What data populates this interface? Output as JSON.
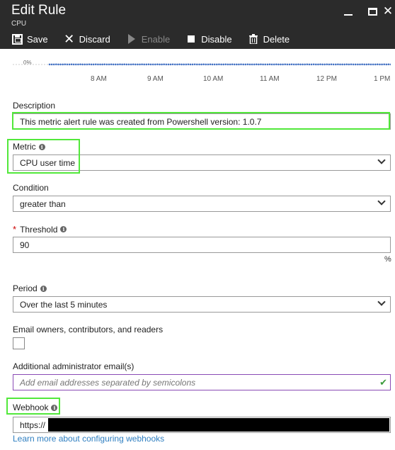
{
  "header": {
    "title": "Edit Rule",
    "subtitle": "CPU",
    "close_glyph": "✕"
  },
  "toolbar": {
    "save_label": "Save",
    "discard_label": "Discard",
    "enable_label": "Enable",
    "disable_label": "Disable",
    "delete_label": "Delete"
  },
  "chart_data": {
    "type": "line",
    "ylabel_tick": "0%",
    "x_ticks": [
      "8 AM",
      "9 AM",
      "10 AM",
      "11 AM",
      "12 PM",
      "1 PM"
    ],
    "series_color": "#4472c4",
    "ylim": [
      0,
      100
    ],
    "values": [
      2,
      3,
      2,
      4,
      3,
      2,
      3,
      5,
      2,
      3,
      4,
      2,
      3,
      2,
      6,
      3,
      2,
      3,
      4,
      2,
      3,
      5,
      2,
      3,
      2,
      4,
      3,
      2,
      5,
      3,
      2,
      3,
      4,
      2,
      6,
      3,
      2,
      3,
      4,
      2,
      3,
      2,
      5,
      3,
      2,
      4,
      3,
      2,
      3,
      5,
      2,
      3,
      4,
      2,
      3,
      2,
      6,
      3,
      2,
      4,
      3,
      2,
      3,
      5,
      2,
      3,
      4,
      2,
      3,
      2,
      5,
      3,
      2,
      4,
      3,
      2,
      3,
      6,
      2,
      3,
      4,
      2,
      3,
      5,
      2,
      3,
      2,
      4,
      3,
      2,
      5,
      3,
      2,
      3,
      4,
      2,
      6,
      3,
      2,
      3,
      4,
      2,
      3,
      5,
      2,
      3,
      2,
      4,
      3,
      2,
      5,
      3,
      2,
      4,
      3,
      2,
      3,
      5,
      2,
      3,
      4,
      2,
      3,
      6,
      2,
      3,
      4,
      2,
      5,
      3,
      2,
      4,
      3,
      2,
      3,
      5,
      2,
      4,
      3,
      2,
      3,
      2,
      5,
      3,
      2,
      4,
      3,
      2,
      3,
      5,
      2,
      3,
      4,
      2,
      6,
      3
    ]
  },
  "form": {
    "description_label": "Description",
    "description_value": "This metric alert rule was created from Powershell version: 1.0.7",
    "metric_label": "Metric",
    "metric_value": "CPU user time",
    "condition_label": "Condition",
    "condition_value": "greater than",
    "threshold_required_mark": "*",
    "threshold_label": "Threshold",
    "threshold_value": "90",
    "threshold_unit": "%",
    "period_label": "Period",
    "period_value": "Over the last 5 minutes",
    "email_owners_label": "Email owners, contributors, and readers",
    "admin_email_label": "Additional administrator email(s)",
    "admin_email_placeholder": "Add email addresses separated by semicolons",
    "webhook_label": "Webhook",
    "webhook_value": "https://",
    "webhook_link": "Learn more about configuring webhooks"
  },
  "colors": {
    "header_bg": "#2b2b2b",
    "highlight": "#52e83b",
    "link": "#2f7fc1",
    "series": "#4472c4"
  }
}
